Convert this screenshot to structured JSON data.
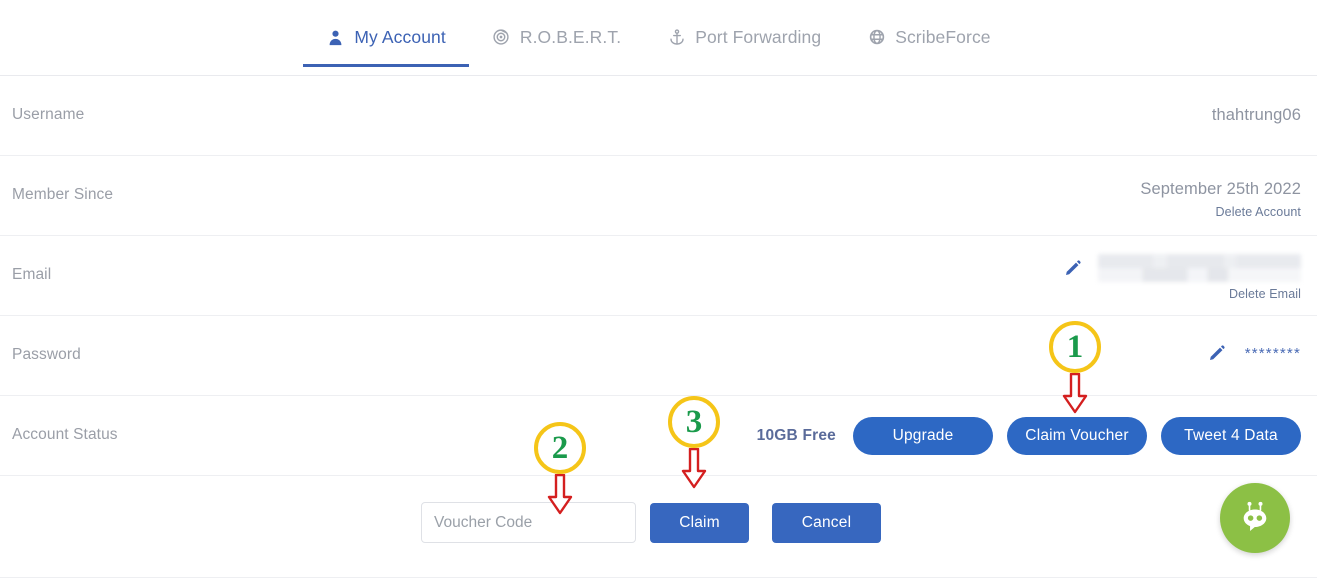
{
  "tabs": [
    {
      "label": "My Account",
      "icon": "user-icon",
      "active": true
    },
    {
      "label": "R.O.B.E.R.T.",
      "icon": "target-icon",
      "active": false
    },
    {
      "label": "Port Forwarding",
      "icon": "anchor-icon",
      "active": false
    },
    {
      "label": "ScribeForce",
      "icon": "globe-icon",
      "active": false
    }
  ],
  "rows": {
    "username": {
      "label": "Username",
      "value": "thahtrung06"
    },
    "member": {
      "label": "Member Since",
      "value": "September 25th 2022",
      "link": "Delete Account"
    },
    "email": {
      "label": "Email",
      "value": "",
      "link": "Delete Email",
      "redacted": true
    },
    "password": {
      "label": "Password",
      "value": "********"
    },
    "status": {
      "label": "Account Status",
      "plan": "10GB Free"
    }
  },
  "status_buttons": {
    "upgrade": "Upgrade",
    "claim_voucher": "Claim Voucher",
    "tweet": "Tweet 4 Data"
  },
  "voucher": {
    "placeholder": "Voucher Code",
    "value": "",
    "claim": "Claim",
    "cancel": "Cancel"
  },
  "chat": {
    "icon": "robot-icon"
  },
  "markers": [
    {
      "number": "1"
    },
    {
      "number": "2"
    },
    {
      "number": "3"
    }
  ],
  "colors": {
    "accent_blue": "#2d68c4",
    "tab_active": "#3c62b4",
    "marker_circle": "#f5c518",
    "marker_number": "#1a9a4b",
    "marker_arrow": "#d41f1f",
    "chat_green": "#8cc045",
    "label_gray": "#9a9ea7"
  }
}
